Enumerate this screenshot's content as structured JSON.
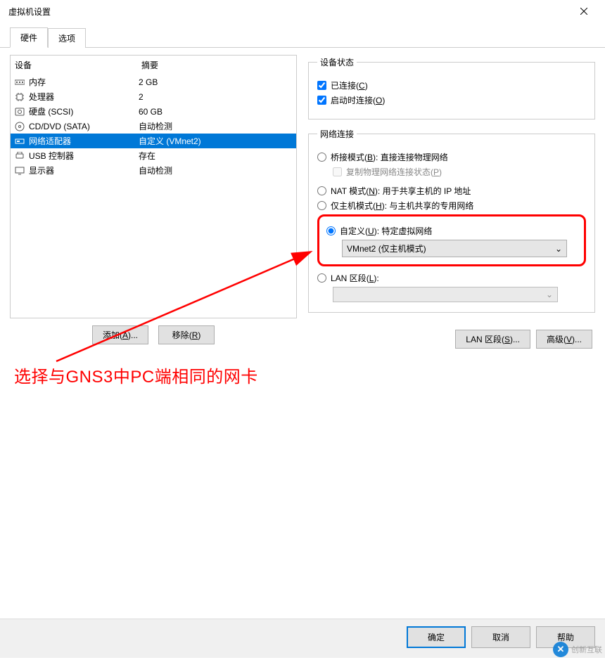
{
  "title": "虚拟机设置",
  "tabs": {
    "hardware": "硬件",
    "options": "选项"
  },
  "columns": {
    "device": "设备",
    "summary": "摘要"
  },
  "devices": [
    {
      "icon": "memory-icon",
      "label": "内存",
      "summary": "2 GB"
    },
    {
      "icon": "cpu-icon",
      "label": "处理器",
      "summary": "2"
    },
    {
      "icon": "disk-icon",
      "label": "硬盘 (SCSI)",
      "summary": "60 GB"
    },
    {
      "icon": "cd-icon",
      "label": "CD/DVD (SATA)",
      "summary": "自动检测"
    },
    {
      "icon": "network-icon",
      "label": "网络适配器",
      "summary": "自定义 (VMnet2)"
    },
    {
      "icon": "usb-icon",
      "label": "USB 控制器",
      "summary": "存在"
    },
    {
      "icon": "display-icon",
      "label": "显示器",
      "summary": "自动检测"
    }
  ],
  "buttons": {
    "add": "添加",
    "add_key": "A",
    "remove": "移除",
    "remove_key": "R",
    "ok": "确定",
    "cancel": "取消",
    "help": "帮助",
    "lan_segments": "LAN 区段",
    "lan_segments_key": "S",
    "advanced": "高级",
    "advanced_key": "V"
  },
  "device_status": {
    "legend": "设备状态",
    "connected": "已连接",
    "connected_key": "C",
    "connect_on_power": "启动时连接",
    "connect_on_power_key": "O"
  },
  "network": {
    "legend": "网络连接",
    "bridged": "桥接模式",
    "bridged_key": "B",
    "bridged_desc": ": 直接连接物理网络",
    "replicate": "复制物理网络连接状态",
    "replicate_key": "P",
    "nat": "NAT 模式",
    "nat_key": "N",
    "nat_desc": ": 用于共享主机的 IP 地址",
    "hostonly": "仅主机模式",
    "hostonly_key": "H",
    "hostonly_desc": ": 与主机共享的专用网络",
    "custom": "自定义",
    "custom_key": "U",
    "custom_desc": ": 特定虚拟网络",
    "custom_value": "VMnet2 (仅主机模式)",
    "lan_segment": "LAN 区段",
    "lan_segment_key": "L",
    "lan_segment_value": ""
  },
  "annotation": "选择与GNS3中PC端相同的网卡",
  "watermark": "创新互联"
}
